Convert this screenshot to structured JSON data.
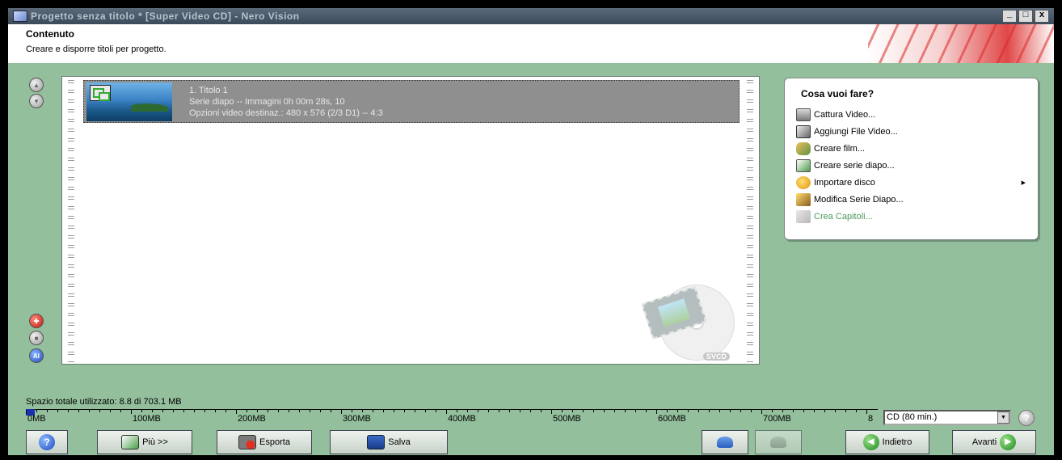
{
  "window": {
    "title": "Progetto senza titolo * [Super Video CD] - Nero Vision",
    "min": "_",
    "max": "□",
    "close": "x"
  },
  "header": {
    "title": "Contenuto",
    "subtitle": "Creare e disporre titoli per progetto."
  },
  "title_item": {
    "line1": "1. Titolo 1",
    "line2": "Serie diapo -- Immagini 0h 00m 28s, 10",
    "line3": "Opzioni video destinaz.: 480 x 576 (2/3 D1) -- 4:3"
  },
  "watermark": {
    "label": "SVCD"
  },
  "task_panel": {
    "title": "Cosa vuoi fare?",
    "items": [
      {
        "label": "Cattura Video...",
        "icon": "video-capture-icon"
      },
      {
        "label": "Aggiungi File Video...",
        "icon": "add-video-file-icon"
      },
      {
        "label": "Creare film...",
        "icon": "create-movie-icon"
      },
      {
        "label": "Creare serie diapo...",
        "icon": "create-slideshow-icon"
      },
      {
        "label": "Importare disco",
        "icon": "import-disc-icon"
      },
      {
        "label": "Modifica Serie Diapo...",
        "icon": "edit-slideshow-icon"
      },
      {
        "label": "Crea Capitoli...",
        "icon": "create-chapters-icon"
      }
    ]
  },
  "disk_space": {
    "label": "Spazio totale utilizzato: 8.8 di 703.1 MB",
    "used_mb": 8.8,
    "total_mb": 703.1,
    "ruler_max_mb": 800,
    "ticks": [
      "0MB",
      "100MB",
      "200MB",
      "300MB",
      "400MB",
      "500MB",
      "600MB",
      "700MB",
      "8"
    ]
  },
  "disc_type": {
    "selected": "CD (80 min.)"
  },
  "buttons": {
    "more": "Più >>",
    "export": "Esporta",
    "save": "Salva",
    "back": "Indietro",
    "next": "Avanti"
  }
}
